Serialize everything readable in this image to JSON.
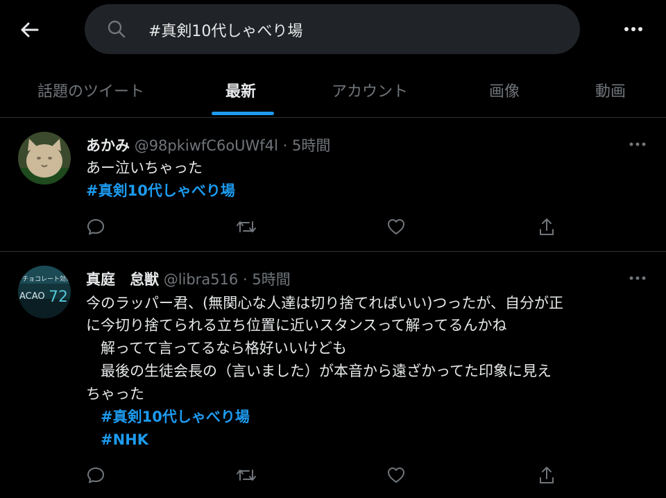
{
  "search": {
    "query": "#真剣10代しゃべり場"
  },
  "tabs": [
    {
      "label": "話題のツイート",
      "active": false
    },
    {
      "label": "最新",
      "active": true
    },
    {
      "label": "アカウント",
      "active": false
    },
    {
      "label": "画像",
      "active": false
    },
    {
      "label": "動画",
      "active": false
    }
  ],
  "tweets": [
    {
      "name": "あかみ",
      "handle": "@98pkiwfC6oUWf4l",
      "separator": "·",
      "time": "5時間",
      "lines": [
        "あー泣いちゃった"
      ],
      "hashtags": [
        "#真剣10代しゃべり場"
      ]
    },
    {
      "name": "真庭　怠獣",
      "handle": "@libra516",
      "separator": "·",
      "time": "5時間",
      "avatar_text": {
        "top": "チョコレート効果",
        "bottom": "ACAO",
        "number": "72"
      },
      "lines": [
        "今のラッパー君、(無関心な人達は切り捨てればいい)つったが、自分が正",
        "に今切り捨てられる立ち位置に近いスタンスって解ってるんかね",
        "　解ってて言ってるなら格好いいけども",
        "　最後の生徒会長の（言いました）が本音から遠ざかってた印象に見え",
        "ちゃった"
      ],
      "hashtags": [
        "　#真剣10代しゃべり場",
        "　#NHK"
      ]
    }
  ],
  "icons": {
    "back": "back-arrow-icon",
    "search": "search-icon",
    "more": "more-icon",
    "reply": "reply-icon",
    "retweet": "retweet-icon",
    "like": "like-icon",
    "share": "share-icon"
  },
  "colors": {
    "accent": "#1d9bf0",
    "background": "#000000",
    "text": "#e7e9ea",
    "muted": "#71767b",
    "search_bg": "#202327",
    "divider": "#2f3336"
  }
}
